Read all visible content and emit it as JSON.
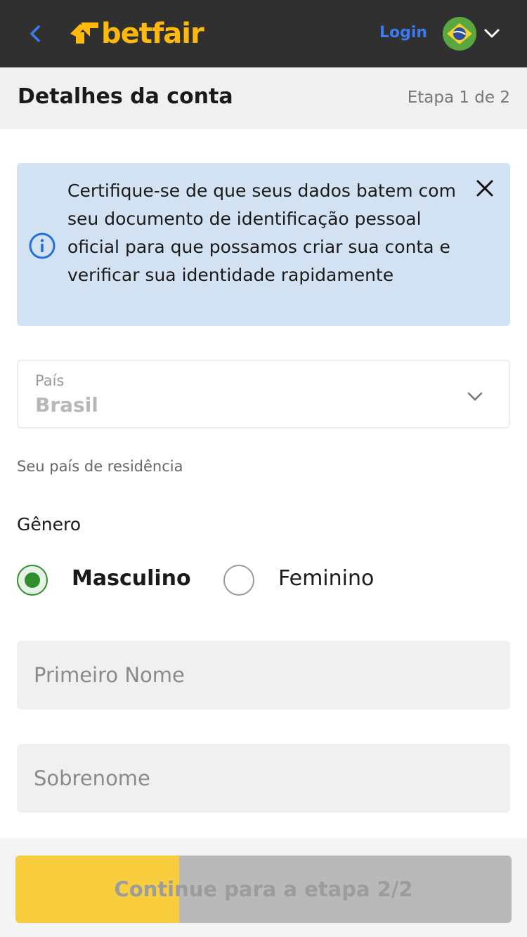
{
  "header": {
    "logo_text": "betfair",
    "login_label": "Login",
    "language_flag": "brazil-flag-icon",
    "colors": {
      "bar": "#303030",
      "logo": "#ffb80c",
      "login": "#3a7cf0"
    }
  },
  "subheader": {
    "title": "Detalhes da conta",
    "step": "Etapa 1 de 2"
  },
  "info_banner": {
    "text": "Certifique-se de que seus dados batem com seu documento de identificação pessoal oficial para que possamos criar sua conta e verificar sua identidade rapidamente",
    "icon": "info-icon",
    "close_icon": "close-icon"
  },
  "country": {
    "label": "País",
    "value": "Brasil",
    "help": "Seu país de residência"
  },
  "gender": {
    "label": "Gênero",
    "options": [
      {
        "label": "Masculino",
        "selected": true
      },
      {
        "label": "Feminino",
        "selected": false
      }
    ]
  },
  "fields": {
    "first_name": {
      "placeholder": "Primeiro Nome",
      "value": ""
    },
    "last_name": {
      "placeholder": "Sobrenome",
      "value": ""
    }
  },
  "footer": {
    "continue_label": "Continue para a etapa 2/2",
    "progress_fraction": 0.33,
    "colors": {
      "fill": "#f8cd3e",
      "track": "#b9b9b9"
    }
  }
}
